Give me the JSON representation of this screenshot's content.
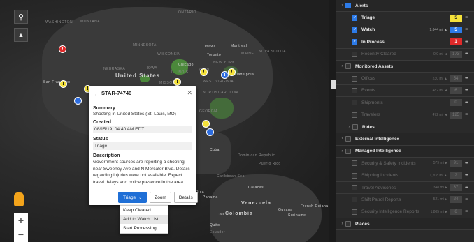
{
  "map": {
    "labels": {
      "washington": "WASHINGTON",
      "montana": "MONTANA",
      "ontario": "ONTARIO",
      "minnesota": "MINNESOTA",
      "wisconsin": "WISCONSIN",
      "ottawa": "Ottawa",
      "montreal": "Montreal",
      "maine": "MAINE",
      "toronto": "Toronto",
      "nova_scotia": "NOVA SCOTIA",
      "new_york": "NEW YORK",
      "chicago": "Chicago",
      "iowa": "IOWA",
      "ohio": "OHIO",
      "philadelphia": "Philadelphia",
      "illinois": "ILLINOIS",
      "united_states": "United States",
      "nebraska": "NEBRASKA",
      "missouri": "MISSOURI",
      "west_virginia": "WEST VIRGINIA",
      "north_carolina": "NORTH CAROLINA",
      "san_francisco": "San Francisco",
      "georgia": "GEORGIA",
      "cuba": "Cuba",
      "dominican_republic": "Dominican Republic",
      "puerto_rico": "Puerto Rico",
      "caribbean_sea": "Caribbean Sea",
      "caracas": "Caracas",
      "panama": "Panama",
      "costa_rica": "Rica",
      "venezuela": "Venezuela",
      "colombia": "Colombia",
      "cali": "Cali",
      "guyana": "Guyana",
      "suriname": "Suriname",
      "french_guiana": "French Guiana",
      "quito": "Quito",
      "ecuador": "Ecuador"
    },
    "markers": [
      {
        "color": "red",
        "glyph": "!"
      },
      {
        "color": "yellow",
        "glyph": "!"
      },
      {
        "color": "yellow",
        "glyph": "!"
      },
      {
        "color": "blue",
        "glyph": "!"
      },
      {
        "color": "yellow",
        "glyph": "!"
      },
      {
        "color": "blue",
        "glyph": "!"
      },
      {
        "color": "yellow",
        "glyph": "!"
      },
      {
        "color": "blue",
        "glyph": "!"
      },
      {
        "color": "yellow",
        "glyph": "!"
      },
      {
        "color": "blue",
        "glyph": "!"
      }
    ],
    "search_icon": "search-icon",
    "terrain_icon": "terrain-icon"
  },
  "popup": {
    "title": "STAR-74746",
    "summary_label": "Summary",
    "summary_value": "Shooting in United States (St. Louis, MO)",
    "created_label": "Created",
    "created_value": "08/15/19, 04:40 AM EDT",
    "status_label": "Status",
    "status_value": "Triage",
    "description_label": "Description",
    "description_value": "Government sources are reporting a shooting near Sweeney Ave and N Mercator Blvd. Details regarding injuries were not available. Expect travel delays and police presence in the area.",
    "actions": {
      "triage": "Triage",
      "zoom": "Zoom",
      "details": "Details"
    },
    "dropdown": [
      "Keep Cleared",
      "Add to Watch List",
      "Start Processing"
    ]
  },
  "panel": {
    "rows": [
      {
        "type": "section",
        "chevron": "›",
        "check": "partial",
        "label": "Alerts"
      },
      {
        "type": "item",
        "check": "on",
        "label": "Triage",
        "dist": "",
        "count": "5",
        "count_bg": "#f5e23a",
        "count_fg": "#222"
      },
      {
        "type": "item",
        "check": "on",
        "label": "Watch",
        "dist": "9,644 mi ▲",
        "count": "5",
        "count_bg": "#2d7be8",
        "count_fg": "#fff"
      },
      {
        "type": "item",
        "check": "on",
        "label": "In Process",
        "dist": "",
        "count": "1",
        "count_bg": "#e02a2a",
        "count_fg": "#fff"
      },
      {
        "type": "item",
        "check": "off",
        "label": "Recently Cleared",
        "dist": "0.0 mi ◄",
        "count": "173",
        "dim": true
      },
      {
        "type": "section",
        "chevron": "›",
        "check": "off",
        "label": "Monitored Assets"
      },
      {
        "type": "item",
        "check": "off",
        "label": "Offices",
        "dist": "230 mi ▲",
        "count": "54",
        "dim": true
      },
      {
        "type": "item",
        "check": "off",
        "label": "Events",
        "dist": "482 mi ◄",
        "count": "6",
        "dim": true
      },
      {
        "type": "item",
        "check": "off",
        "label": "Shipments",
        "dist": "",
        "count": "0",
        "dim": true
      },
      {
        "type": "item",
        "check": "off",
        "label": "Travelers",
        "dist": "472 mi ◄",
        "count": "125",
        "dim": true
      },
      {
        "type": "subsection",
        "chevron": "›",
        "check": "off",
        "label": "Rides"
      },
      {
        "type": "section",
        "chevron": "›",
        "check": "off",
        "label": "External Intelligence"
      },
      {
        "type": "section",
        "chevron": "›",
        "check": "off",
        "label": "Managed Intelligence"
      },
      {
        "type": "item",
        "check": "off",
        "label": "Security & Safety Incidents",
        "dist": "579 mi ▶",
        "count": "91",
        "dim": true
      },
      {
        "type": "item",
        "check": "off",
        "label": "Shipping Incidents",
        "dist": "1,208 mi ▲",
        "count": "2",
        "dim": true
      },
      {
        "type": "item",
        "check": "off",
        "label": "Travel Advisories",
        "dist": "348 mi ▶",
        "count": "37",
        "dim": true
      },
      {
        "type": "item",
        "check": "off",
        "label": "Shift Patrol Reports",
        "dist": "521 mi ▶",
        "count": "24",
        "dim": true
      },
      {
        "type": "item",
        "check": "off",
        "label": "Security Intelligence Reports",
        "dist": "1,805 mi ▶",
        "count": "6",
        "dim": true
      },
      {
        "type": "section",
        "chevron": "›",
        "check": "off",
        "label": "Places"
      }
    ]
  }
}
